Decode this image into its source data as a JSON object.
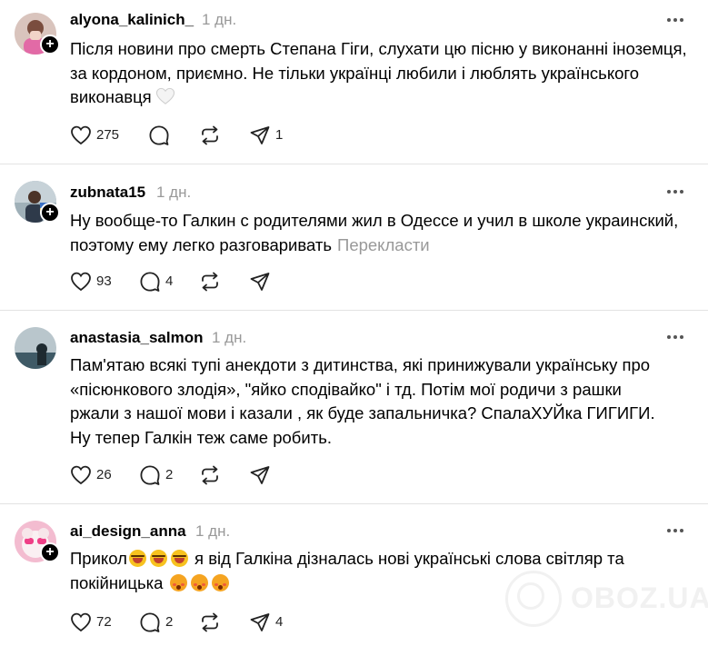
{
  "posts": [
    {
      "username": "alyona_kalinich_",
      "time": "1 дн.",
      "text": "Після новини про смерть Степана Гіги, слухати цю пісню у виконанні іноземця, за кордоном, приємно. Не тільки українці любили і люблять українського виконавця",
      "likes": "275",
      "replies": "",
      "reposts": "",
      "shares": "1"
    },
    {
      "username": "zubnata15",
      "time": "1 дн.",
      "text": "Ну вообще-то Галкин с родителями жил в Одессе и учил в школе украинский, поэтому ему легко разговаривать",
      "translate": "Перекласти",
      "likes": "93",
      "replies": "4",
      "reposts": "",
      "shares": ""
    },
    {
      "username": "anastasia_salmon",
      "time": "1 дн.",
      "text": "Пам'ятаю всякі тупі анекдоти з дитинства, які принижували українську про «пісюнкового злодія», \"яйко сподівайко\" і тд. Потім мої родичи з рашки ржали з нашої мови і казали , як буде запальничка? СпалаХУЙка ГИГИГИ. Ну тепер Галкін теж саме робить.",
      "likes": "26",
      "replies": "2",
      "reposts": "",
      "shares": ""
    },
    {
      "username": "ai_design_anna",
      "time": "1 дн.",
      "text_a": "Прикол",
      "text_b": " я від Галкіна дізналась нові українські слова світляр та покійницька",
      "likes": "72",
      "replies": "2",
      "reposts": "",
      "shares": "4"
    }
  ],
  "icons": {
    "like": "heart-icon",
    "reply": "comment-icon",
    "repost": "repost-icon",
    "share": "share-icon",
    "more": "more-icon",
    "follow": "plus-icon"
  },
  "watermark": {
    "text": "OBOZ.UA"
  },
  "colors": {
    "muted": "#999999",
    "separator": "#e3e3e3",
    "text": "#000000"
  }
}
